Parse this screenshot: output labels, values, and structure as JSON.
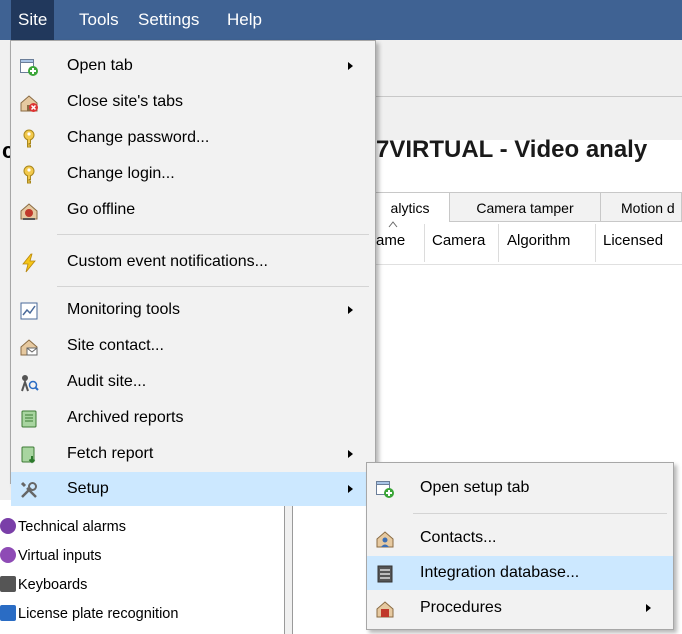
{
  "menubar": {
    "items": [
      {
        "label": "Site"
      },
      {
        "label": "Tools"
      },
      {
        "label": "Settings"
      },
      {
        "label": "Help"
      }
    ]
  },
  "background": {
    "page_title": "7VIRTUAL - Video analy",
    "left_letter": "c",
    "tabs": [
      {
        "label": "alytics"
      },
      {
        "label": "Camera tamper"
      },
      {
        "label": "Motion d"
      }
    ],
    "columns": [
      "ame",
      "Camera",
      "Algorithm",
      "Licensed"
    ],
    "tree_items": [
      {
        "label": "Technical alarms",
        "color": "#7a3fa8"
      },
      {
        "label": "Virtual inputs",
        "color": "#8e4bb5"
      },
      {
        "label": "Keyboards",
        "color": "#555555"
      },
      {
        "label": "License plate recognition",
        "color": "#2a6cc4"
      }
    ]
  },
  "site_menu": {
    "items": [
      {
        "label": "Open tab",
        "icon": "open-tab-icon",
        "has_submenu": true
      },
      {
        "label": "Close site's tabs",
        "icon": "close-tabs-icon"
      },
      {
        "label": "Change password...",
        "icon": "key-icon"
      },
      {
        "label": "Change login...",
        "icon": "key-icon"
      },
      {
        "label": "Go offline",
        "icon": "go-offline-icon"
      },
      {
        "label": "Custom event notifications...",
        "icon": "lightning-icon"
      },
      {
        "label": "Monitoring tools",
        "icon": "chart-icon",
        "has_submenu": true
      },
      {
        "label": "Site contact...",
        "icon": "site-contact-icon"
      },
      {
        "label": "Audit site...",
        "icon": "audit-icon"
      },
      {
        "label": "Archived reports",
        "icon": "archive-icon"
      },
      {
        "label": "Fetch report",
        "icon": "fetch-report-icon",
        "has_submenu": true
      },
      {
        "label": "Setup",
        "icon": "tools-icon",
        "has_submenu": true,
        "highlighted": true
      }
    ]
  },
  "setup_submenu": {
    "items": [
      {
        "label": "Open setup tab",
        "icon": "open-tab-icon"
      },
      {
        "label": "Contacts...",
        "icon": "contacts-icon"
      },
      {
        "label": "Integration database...",
        "icon": "database-icon",
        "highlighted": true
      },
      {
        "label": "Procedures",
        "icon": "procedures-icon",
        "has_submenu": true
      }
    ]
  },
  "colors": {
    "menubar": "#3f6293",
    "menubar_active": "#21385c",
    "menu_background": "#f2f2f2",
    "highlight": "#cce8ff"
  }
}
